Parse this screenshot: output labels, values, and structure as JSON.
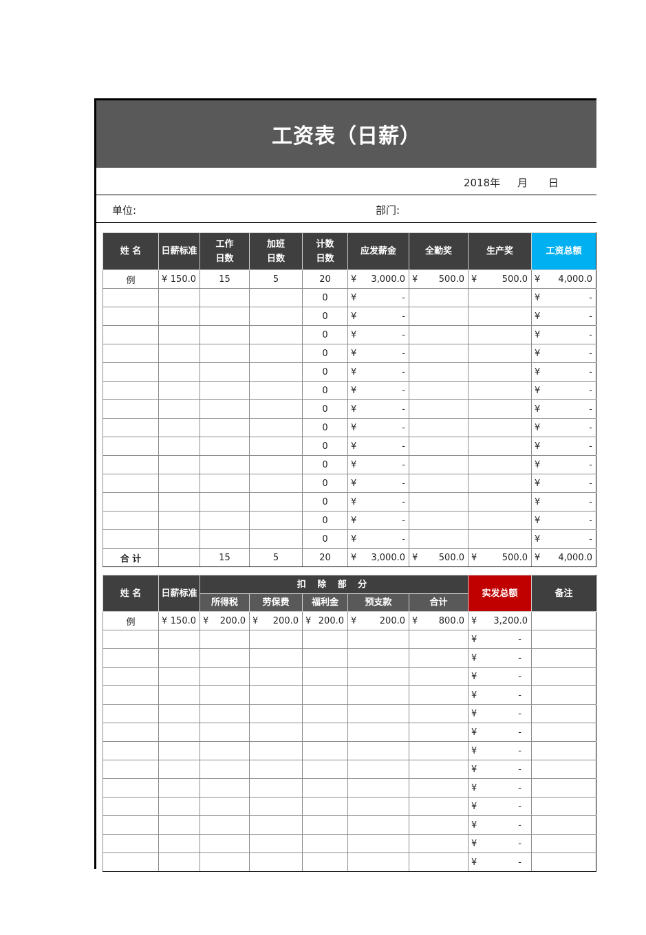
{
  "title": "工资表（日薪）",
  "date": {
    "year": "2018年",
    "month": "月",
    "day": "日"
  },
  "unit_label": "单位:",
  "dept_label": "部门:",
  "colors": {
    "title_bg": "#595959",
    "header_bg": "#3f3f3f",
    "accent_blue": "#00b0f0",
    "accent_red": "#c00000"
  },
  "table1": {
    "headers": [
      "姓 名",
      "日薪标准",
      "工作\n日数",
      "加班\n日数",
      "计数\n日数",
      "应发薪金",
      "全勤奖",
      "生产奖",
      "工资总额"
    ],
    "header_lines": {
      "work_days": [
        "工作",
        "日数"
      ],
      "overtime_days": [
        "加班",
        "日数"
      ],
      "count_days": [
        "计数",
        "日数"
      ]
    },
    "example": {
      "name": "例",
      "daily_rate": "150.0",
      "work_days": "15",
      "overtime_days": "5",
      "count_days": "20",
      "gross_pay": "3,000.0",
      "attendance_bonus": "500.0",
      "production_bonus": "500.0",
      "total": "4,000.0"
    },
    "empty_rows": 14,
    "empty_row": {
      "count_days": "0",
      "gross_pay": "-",
      "total": "-"
    },
    "totals": {
      "label": "合 计",
      "work_days": "15",
      "overtime_days": "5",
      "count_days": "20",
      "gross_pay": "3,000.0",
      "attendance_bonus": "500.0",
      "production_bonus": "500.0",
      "total": "4,000.0"
    },
    "currency": "¥"
  },
  "table2": {
    "headers": {
      "name": "姓 名",
      "daily_rate": "日薪标准",
      "deductions": "扣 除 部 分",
      "income_tax": "所得税",
      "labor_insurance": "劳保费",
      "welfare": "福利金",
      "advance": "预支款",
      "subtotal": "合计",
      "net_total": "实发总额",
      "remarks": "备注"
    },
    "example": {
      "name": "例",
      "daily_rate": "150.0",
      "income_tax": "200.0",
      "labor_insurance": "200.0",
      "welfare": "200.0",
      "advance": "200.0",
      "subtotal": "800.0",
      "net_total": "3,200.0"
    },
    "empty_rows": 13,
    "empty_row": {
      "net_total": "-"
    },
    "currency": "¥"
  }
}
